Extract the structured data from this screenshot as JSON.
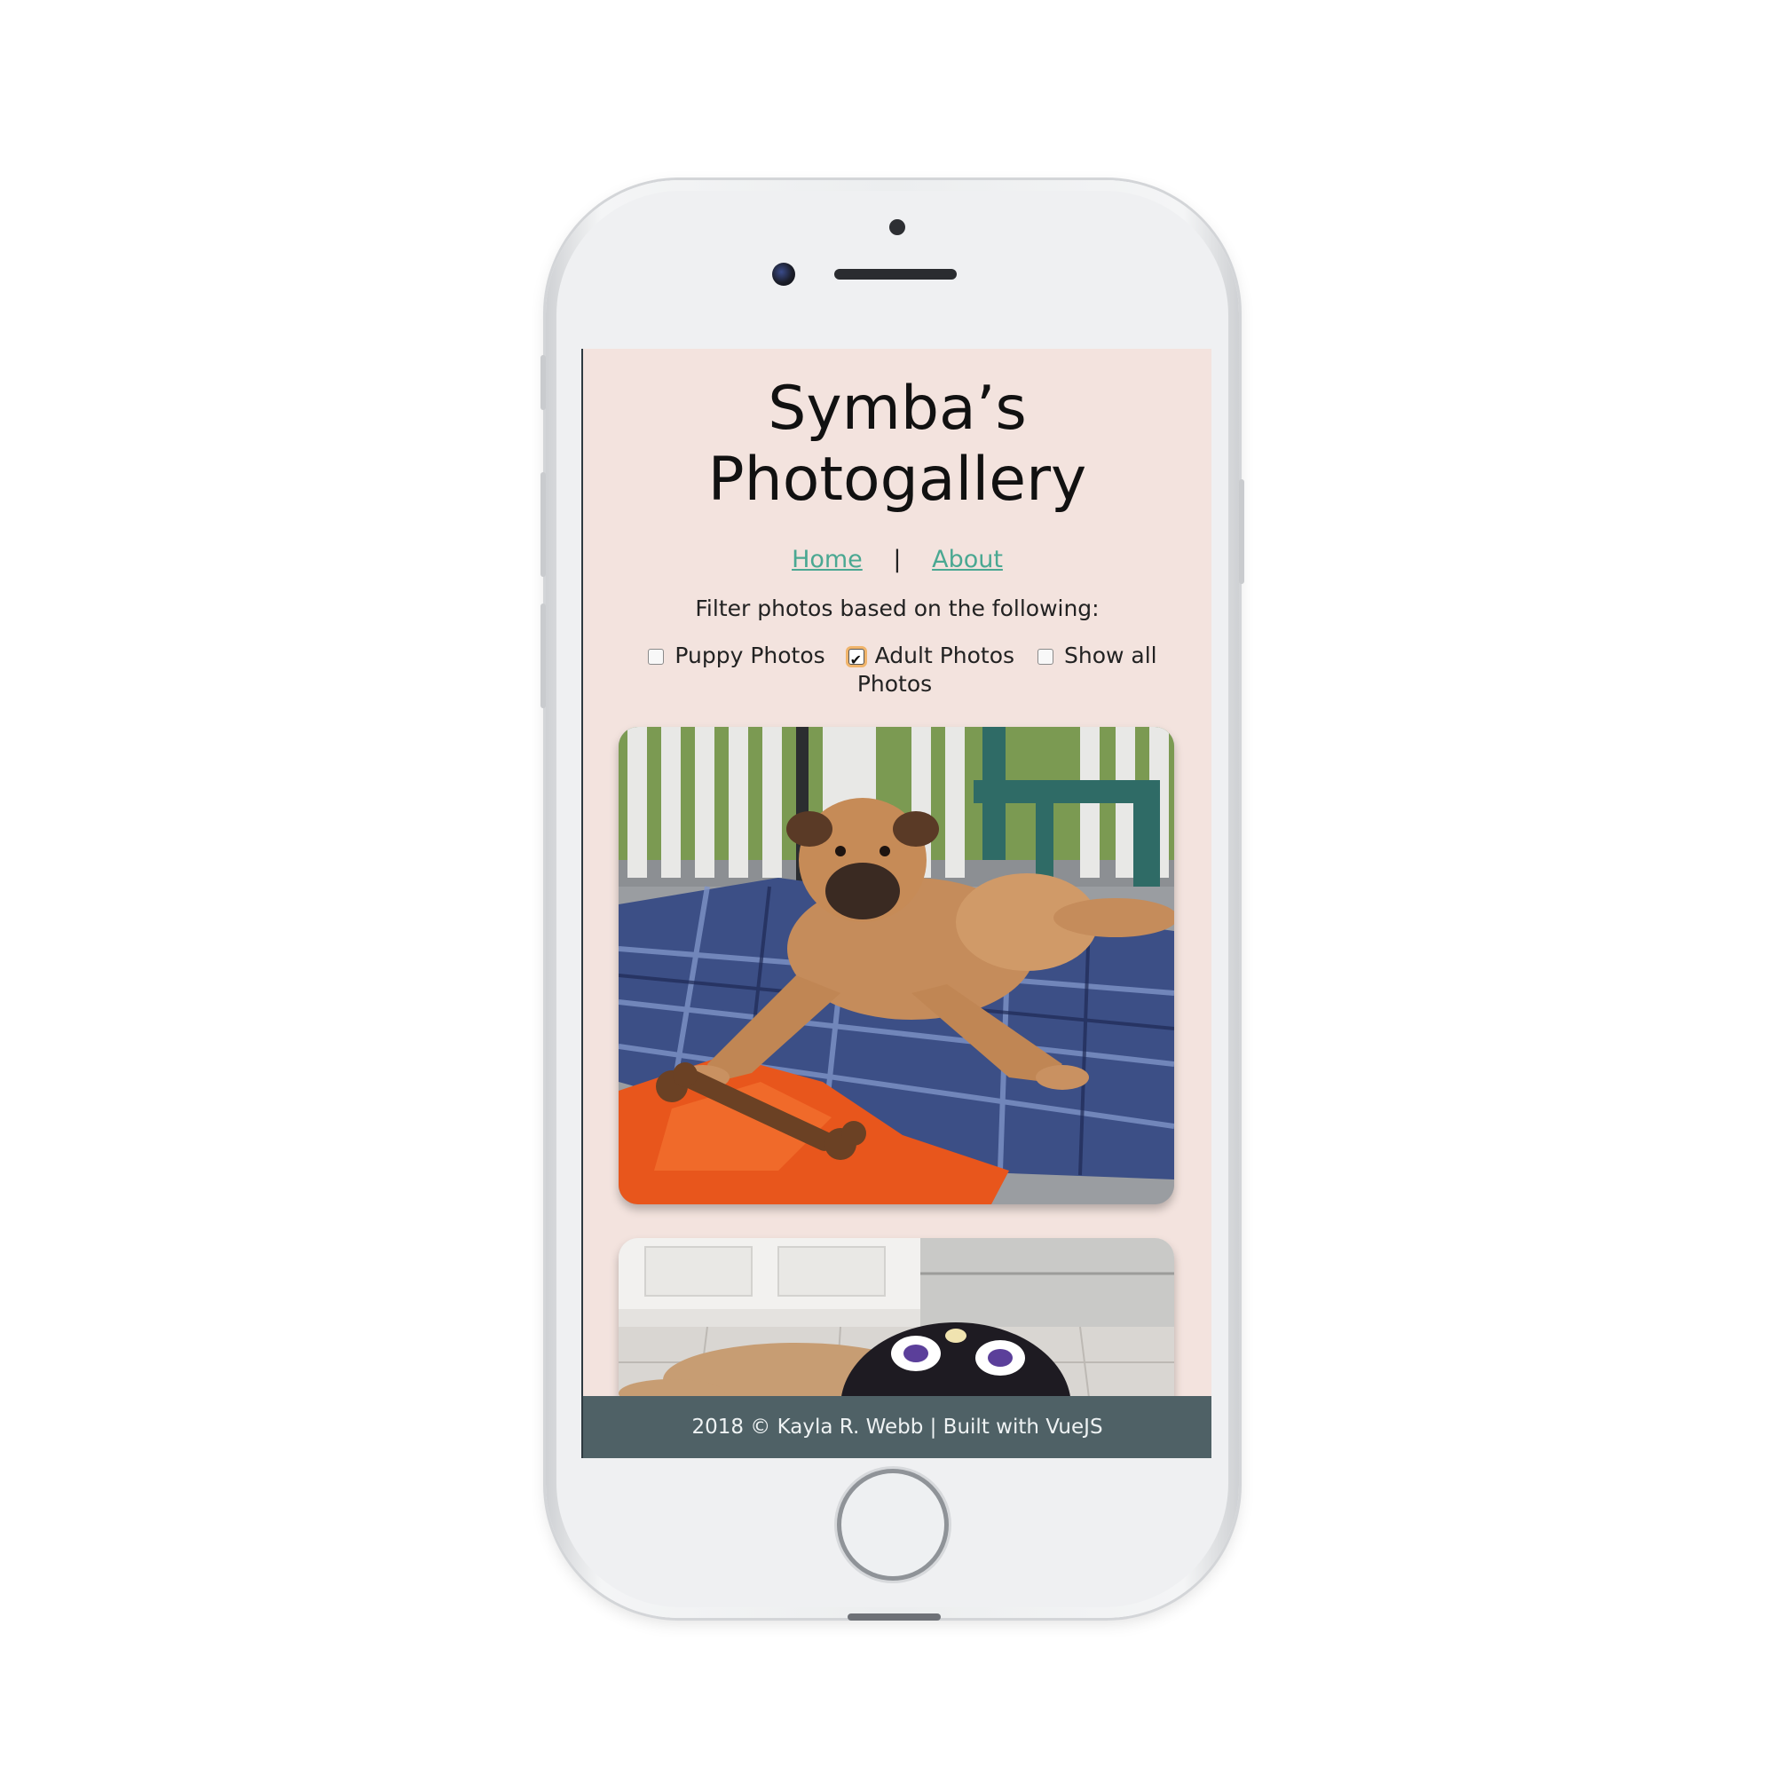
{
  "page": {
    "title": "Symba’s Photogallery"
  },
  "nav": {
    "home_label": "Home",
    "separator": "|",
    "about_label": "About"
  },
  "filters": {
    "prompt": "Filter photos based on the following:",
    "options": [
      {
        "label": "Puppy Photos",
        "checked": false
      },
      {
        "label": "Adult Photos",
        "checked": true
      },
      {
        "label": "Show all Photos",
        "checked": false
      }
    ]
  },
  "gallery": {
    "photos": [
      {
        "subject": "dog-lying-on-blanket-with-bone"
      },
      {
        "subject": "dog-lying-on-tile-floor-in-jersey"
      }
    ]
  },
  "footer": {
    "text": "2018 © Kayla R. Webb | Built with VueJS"
  },
  "colors": {
    "page_background": "#f3e3de",
    "link": "#4aa892",
    "footer_background": "#4f6166",
    "checkbox_focus": "#f0b46b"
  }
}
